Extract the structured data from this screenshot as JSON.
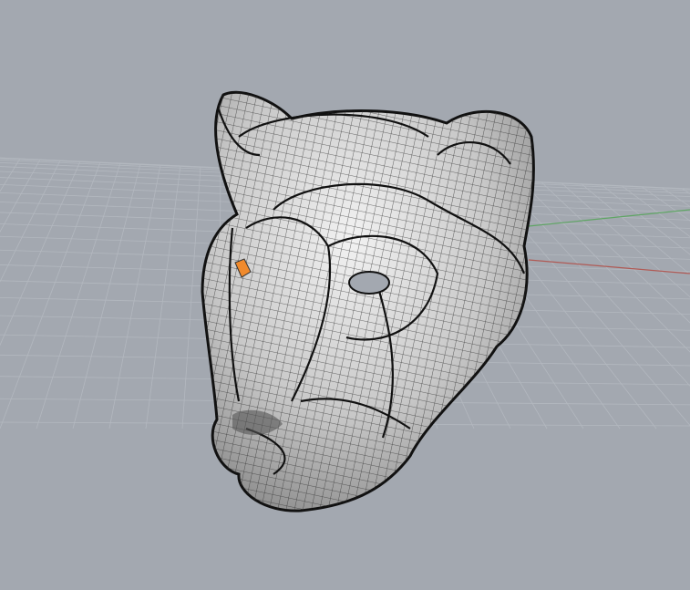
{
  "viewport": {
    "view": "perspective",
    "background_color": "#a3a8b0",
    "grid_color": "#b3b8bf",
    "x_axis_color": "#b05a55",
    "y_axis_color": "#5fa564",
    "model": {
      "subject": "panther-head",
      "display_mode": "shaded-wireframe",
      "surface_color": "#d4d4d4",
      "wire_color": "#1e1e1e",
      "selected_accent": "#f08a2c"
    }
  }
}
